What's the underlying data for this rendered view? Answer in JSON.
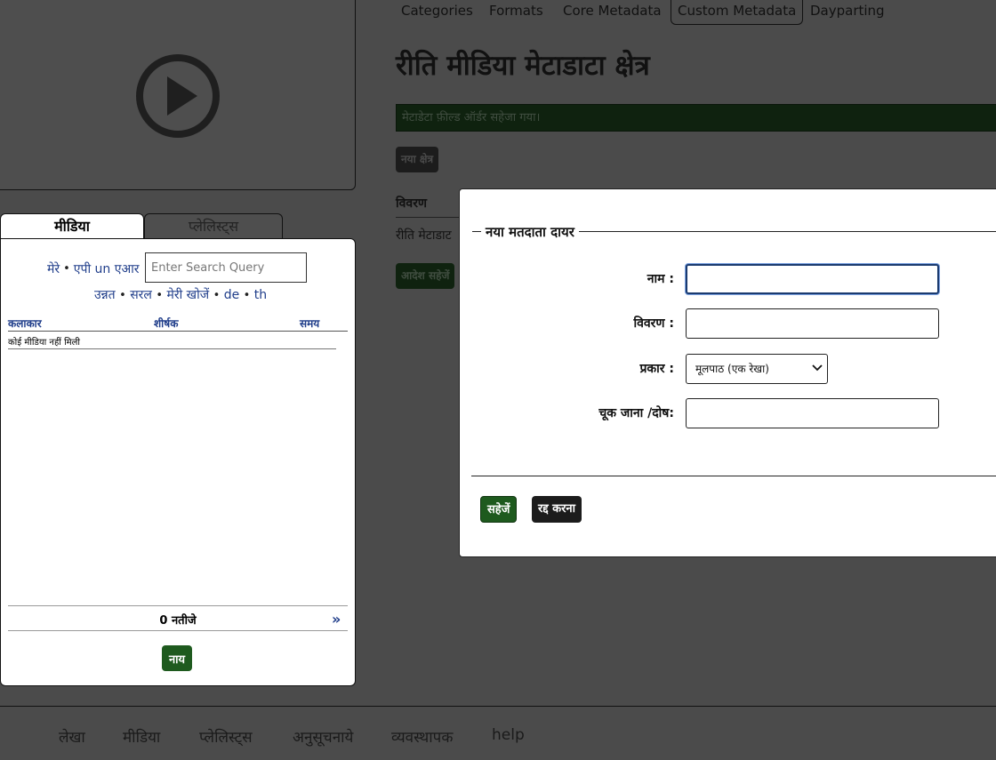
{
  "top_nav": {
    "categories": "Categories",
    "formats": "Formats",
    "core_metadata": "Core Metadata",
    "custom_metadata": "Custom Metadata",
    "dayparting": "Dayparting"
  },
  "main": {
    "title": "रीति मीडिया मेटाडाटा क्षेत्र",
    "success_message": "मेटाडेटा फ़ील्ड ऑर्डर सहेजा गया।",
    "new_field_button": "नया क्षेत्र",
    "description_header": "विवरण",
    "description_row": "रीति मेटाडाट",
    "save_order_button": "आदेश सहेजें"
  },
  "sidebar": {
    "tabs": {
      "media": "मीडिया",
      "playlists": "प्लेलिस्ट्स"
    },
    "search": {
      "my_link": "मेरे",
      "bullet": "•",
      "unaired_link": "एपी un एआर",
      "placeholder": "Enter Search Query",
      "advanced_link": "उन्नत",
      "simple_link": "सरल",
      "my_searches_link": "मेरी खोजें",
      "de_link": "de",
      "th_link": "th"
    },
    "table": {
      "headers": {
        "artist": "कलाकार",
        "title": "शीर्षक",
        "time": "समय"
      },
      "empty_message": "कोई मीडिया नहीं मिली"
    },
    "results_count": "0 नतीजे",
    "new_button": "नाय"
  },
  "dialog": {
    "legend": "नया मतदाता दायर",
    "fields": {
      "name_label": "नाम :",
      "name_value": "",
      "description_label": "विवरण :",
      "description_value": "",
      "type_label": "प्रकार :",
      "type_selected": "मूलपाठ (एक रेखा)",
      "default_label": "चूक जाना /दोष:",
      "default_value": ""
    },
    "save_button": "सहेजें",
    "cancel_button": "रद्द करना"
  },
  "footer": {
    "account": "लेखा",
    "media": "मीडिया",
    "playlists": "प्लेलिस्ट्स",
    "schedules": "अनुसूचनाये",
    "admin": "व्यवस्थापक",
    "help": "help"
  },
  "icons": {
    "play": "play-icon",
    "next": "double-chevron-right-icon",
    "select_arrow": "chevron-down-icon"
  },
  "colors": {
    "overlay_background": "#4b4b4b",
    "accent_green": "#1e5a1e",
    "link_blue": "#1f3d8a",
    "focus_border": "#1b3b6f"
  }
}
